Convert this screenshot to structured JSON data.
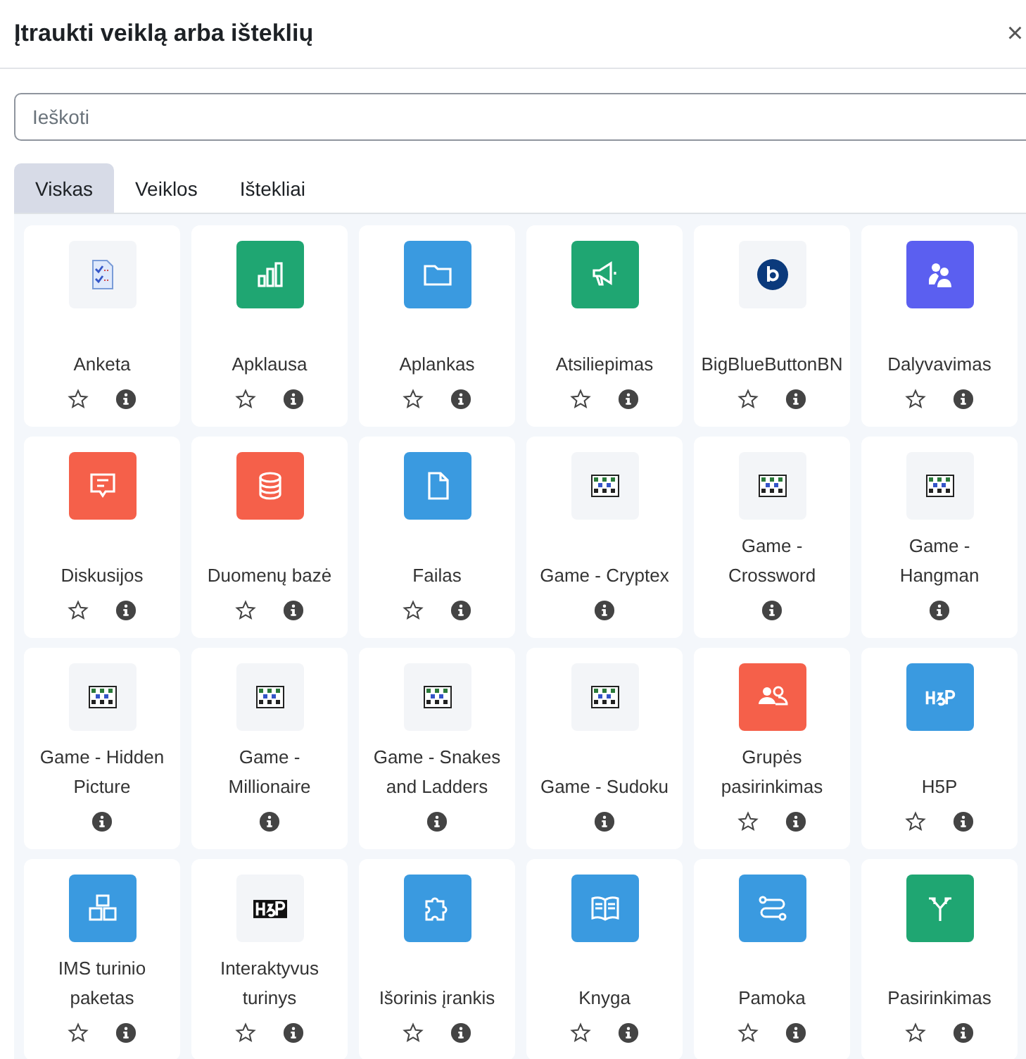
{
  "dialog": {
    "title": "Įtraukti veiklą arba išteklių",
    "close": "×"
  },
  "search": {
    "placeholder": "Ieškoti"
  },
  "tabs": [
    {
      "label": "Viskas",
      "selected": true
    },
    {
      "label": "Veiklos",
      "selected": false
    },
    {
      "label": "Ištekliai",
      "selected": false
    }
  ],
  "items": [
    {
      "label": "Anketa",
      "kind": "survey",
      "star": true
    },
    {
      "label": "Apklausa",
      "kind": "chart",
      "color": "#1fa672",
      "star": true
    },
    {
      "label": "Aplankas",
      "kind": "folder",
      "color": "#3a9ae0",
      "star": true
    },
    {
      "label": "Atsiliepimas",
      "kind": "megaphone",
      "color": "#1fa672",
      "star": true
    },
    {
      "label": "BigBlueButtonBN",
      "kind": "bbb",
      "star": true
    },
    {
      "label": "Dalyvavimas",
      "kind": "people",
      "color": "#5b5ff0",
      "star": true
    },
    {
      "label": "Diskusijos",
      "kind": "forum",
      "color": "#f5604a",
      "star": true
    },
    {
      "label": "Duomenų bazė",
      "kind": "database",
      "color": "#f5604a",
      "star": true
    },
    {
      "label": "Failas",
      "kind": "file",
      "color": "#3a9ae0",
      "star": true
    },
    {
      "label": "Game - Cryptex",
      "kind": "game",
      "star": false
    },
    {
      "label": "Game - Crossword",
      "kind": "game",
      "star": false
    },
    {
      "label": "Game - Hangman",
      "kind": "game",
      "star": false
    },
    {
      "label": "Game - Hidden Picture",
      "kind": "game",
      "star": false
    },
    {
      "label": "Game - Millionaire",
      "kind": "game",
      "star": false
    },
    {
      "label": "Game - Snakes and Ladders",
      "kind": "game",
      "star": false
    },
    {
      "label": "Game - Sudoku",
      "kind": "game",
      "star": false
    },
    {
      "label": "Grupės pasirinkimas",
      "kind": "group",
      "color": "#f5604a",
      "star": true
    },
    {
      "label": "H5P",
      "kind": "h5p",
      "color": "#3a9ae0",
      "star": true
    },
    {
      "label": "IMS turinio paketas",
      "kind": "package",
      "color": "#3a9ae0",
      "star": true
    },
    {
      "label": "Interaktyvus turinys",
      "kind": "h5pdark",
      "star": true
    },
    {
      "label": "Išorinis įrankis",
      "kind": "puzzle",
      "color": "#3a9ae0",
      "star": true
    },
    {
      "label": "Knyga",
      "kind": "book",
      "color": "#3a9ae0",
      "star": true
    },
    {
      "label": "Pamoka",
      "kind": "path",
      "color": "#3a9ae0",
      "star": true
    },
    {
      "label": "Pasirinkimas",
      "kind": "branch",
      "color": "#1fa672",
      "star": true
    }
  ]
}
